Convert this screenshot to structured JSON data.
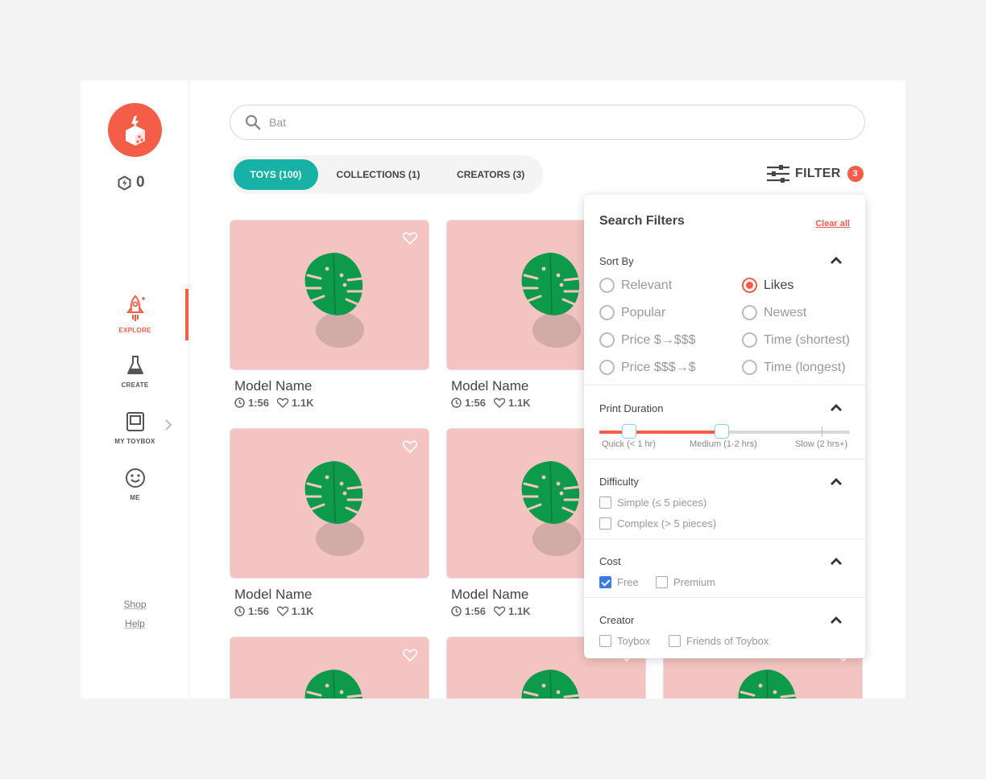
{
  "coins": "0",
  "nav": [
    {
      "label": "EXPLORE",
      "icon": "rocket-icon"
    },
    {
      "label": "CREATE",
      "icon": "flask-icon"
    },
    {
      "label": "MY TOYBOX",
      "icon": "toybox-icon"
    },
    {
      "label": "ME",
      "icon": "smiley-icon"
    }
  ],
  "links": {
    "shop": "Shop",
    "help": "Help"
  },
  "search": {
    "value": "Bat"
  },
  "tabs": [
    {
      "label": "TOYS (100)",
      "active": true
    },
    {
      "label": "COLLECTIONS (1)",
      "active": false
    },
    {
      "label": "CREATORS (3)",
      "active": false
    }
  ],
  "filter": {
    "label": "FILTER",
    "count": "3"
  },
  "cards": [
    {
      "name": "Model Name",
      "time": "1:56",
      "likes": "1.1K"
    },
    {
      "name": "Model Name",
      "time": "1:56",
      "likes": "1.1K"
    },
    {
      "name": "Model Name",
      "time": "1:56",
      "likes": "1.1K"
    },
    {
      "name": "Model Name",
      "time": "1:56",
      "likes": "1.1K"
    }
  ],
  "panel": {
    "title": "Search Filters",
    "clear": "Clear all",
    "sort_title": "Sort By",
    "sort": [
      "Relevant",
      "Likes",
      "Popular",
      "Newest",
      "Price $→$$$",
      "Time (shortest)",
      "Price $$$→$",
      "Time (longest)"
    ],
    "sort_selected": "Likes",
    "duration_title": "Print Duration",
    "duration_labels": [
      "Quick (< 1 hr)",
      "Medium (1-2 hrs)",
      "Slow (2 hrs+)"
    ],
    "difficulty_title": "Difficulty",
    "difficulty": [
      "Simple (≤ 5 pieces)",
      "Complex (> 5 pieces)"
    ],
    "cost_title": "Cost",
    "cost": [
      "Free",
      "Premium"
    ],
    "cost_checked": "Free",
    "creator_title": "Creator",
    "creator": [
      "Toybox",
      "Friends of Toybox"
    ]
  },
  "colors": {
    "accent": "#f45d48",
    "teal": "#17b1a6",
    "card": "#f3c4c1",
    "leaf": "#0d9a4a",
    "check": "#3b7ae8"
  }
}
